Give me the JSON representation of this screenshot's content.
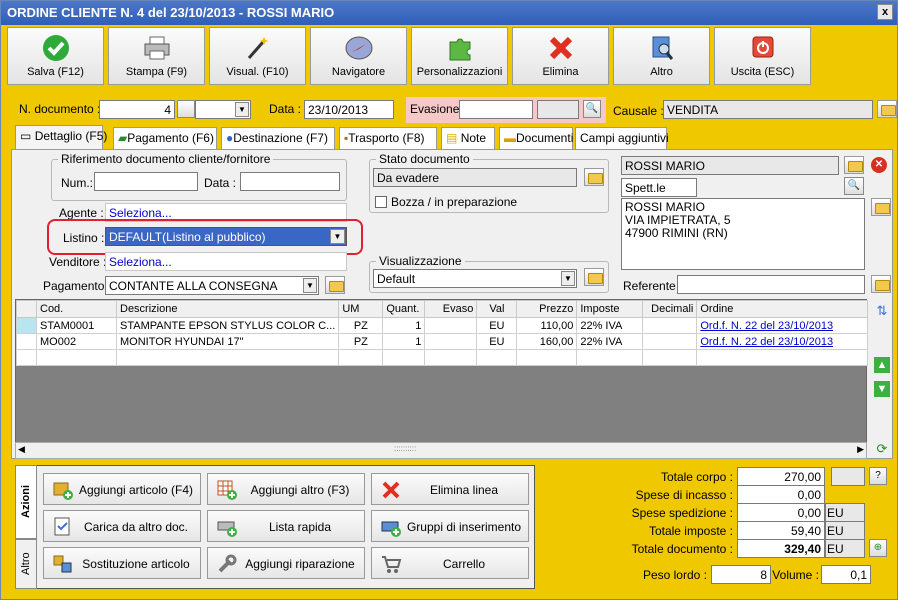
{
  "window": {
    "title": "ORDINE CLIENTE N. 4 del 23/10/2013 - ROSSI MARIO",
    "close": "x"
  },
  "toolbar": [
    {
      "label": "Salva (F12)",
      "icon": "check-icon"
    },
    {
      "label": "Stampa (F9)",
      "icon": "printer-icon"
    },
    {
      "label": "Visual. (F10)",
      "icon": "magic-wand-icon"
    },
    {
      "label": "Navigatore",
      "icon": "compass-icon"
    },
    {
      "label": "Personalizzazioni",
      "icon": "puzzle-icon"
    },
    {
      "label": "Elimina",
      "icon": "delete-x-icon"
    },
    {
      "label": "Altro",
      "icon": "search-doc-icon"
    },
    {
      "label": "Uscita (ESC)",
      "icon": "power-icon"
    }
  ],
  "header": {
    "ndoc_label": "N. documento :",
    "ndoc_value": "4",
    "data_label": "Data :",
    "data_value": "23/10/2013",
    "evasione_label": "Evasione:",
    "evasione_value": "",
    "causale_label": "Causale :",
    "causale_value": "VENDITA"
  },
  "tabs": [
    "Dettaglio (F5)",
    "Pagamento (F6)",
    "Destinazione (F7)",
    "Trasporto (F8)",
    "Note",
    "Documenti",
    "Campi aggiuntivi"
  ],
  "riferimento": {
    "title": "Riferimento documento cliente/fornitore",
    "num_label": "Num.:",
    "num_value": "",
    "data_label": "Data :",
    "data_value": ""
  },
  "stato": {
    "title": "Stato documento",
    "value": "Da evadere",
    "checkbox_label": "Bozza / in preparazione"
  },
  "cliente": {
    "name": "ROSSI MARIO",
    "spett": "Spett.le",
    "address": [
      "ROSSI MARIO",
      "VIA IMPIETRATA, 5",
      "47900 RIMINI (RN)"
    ],
    "referente_label": "Referente",
    "referente_value": ""
  },
  "fields": {
    "agente_label": "Agente :",
    "agente_value": "Seleziona...",
    "listino_label": "Listino :",
    "listino_value": "DEFAULT(Listino al pubblico)",
    "venditore_label": "Venditore :",
    "venditore_value": "Seleziona...",
    "pagamento_label": "Pagamento :",
    "pagamento_value": "CONTANTE ALLA CONSEGNA"
  },
  "visualizzazione": {
    "title": "Visualizzazione",
    "value": "Default"
  },
  "grid": {
    "columns": [
      "Cod.",
      "Descrizione",
      "UM",
      "Quant.",
      "Evaso",
      "Val",
      "Prezzo",
      "Imposte",
      "Decimali",
      "Ordine"
    ],
    "rows": [
      [
        "STAM0001",
        "STAMPANTE EPSON STYLUS COLOR C...",
        "PZ",
        "1",
        "",
        "EU",
        "110,00",
        "22% IVA",
        "",
        "Ord.f. N. 22 del 23/10/2013"
      ],
      [
        "MO002",
        "MONITOR HYUNDAI 17\"",
        "PZ",
        "1",
        "",
        "EU",
        "160,00",
        "22% IVA",
        "",
        "Ord.f. N. 22 del 23/10/2013"
      ]
    ],
    "scroll_grip": "::::::::::"
  },
  "side_tabs": [
    "Azioni",
    "Altro"
  ],
  "actions": [
    {
      "label": "Aggiungi articolo (F4)",
      "icon": "add-box-icon"
    },
    {
      "label": "Aggiungi altro (F3)",
      "icon": "add-grid-icon"
    },
    {
      "label": "Elimina linea",
      "icon": "delete-x-icon"
    },
    {
      "label": "Carica da altro doc.",
      "icon": "load-doc-icon"
    },
    {
      "label": "Lista rapida",
      "icon": "scanner-icon"
    },
    {
      "label": "Gruppi di inserimento",
      "icon": "group-insert-icon"
    },
    {
      "label": "Sostituzione articolo",
      "icon": "replace-icon"
    },
    {
      "label": "Aggiungi riparazione",
      "icon": "wrench-icon"
    },
    {
      "label": "Carrello",
      "icon": "cart-icon"
    }
  ],
  "totals": {
    "corpo_label": "Totale corpo :",
    "corpo_value": "270,00",
    "help": "?",
    "incasso_label": "Spese di incasso :",
    "incasso_value": "0,00",
    "spedizione_label": "Spese spedizione :",
    "spedizione_value": "0,00",
    "spedizione_unit": "EU",
    "imposte_label": "Totale imposte :",
    "imposte_value": "59,40",
    "imposte_unit": "EU",
    "documento_label": "Totale documento :",
    "documento_value": "329,40",
    "documento_unit": "EU",
    "peso_label": "Peso lordo :",
    "peso_value": "8",
    "volume_label": "Volume :",
    "volume_value": "0,1"
  }
}
